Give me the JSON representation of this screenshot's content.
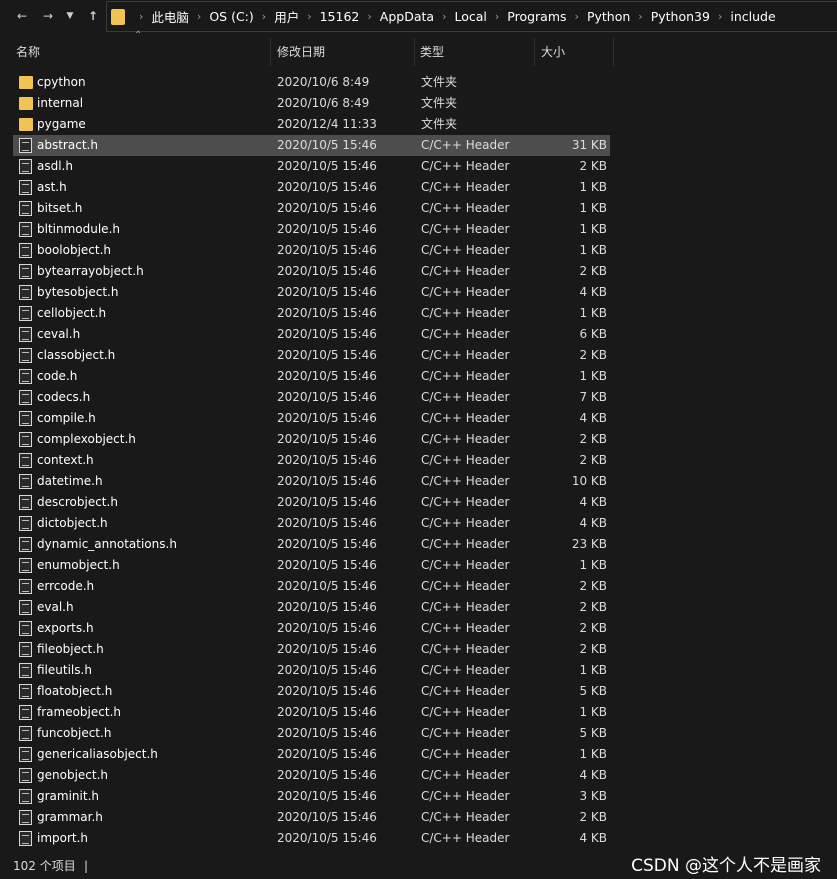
{
  "nav": {
    "back_icon": "arrow-left-icon",
    "forward_icon": "arrow-right-icon",
    "recent_icon": "chevron-down-icon",
    "up_icon": "arrow-up-icon"
  },
  "breadcrumb": [
    "此电脑",
    "OS (C:)",
    "用户",
    "15162",
    "AppData",
    "Local",
    "Programs",
    "Python",
    "Python39",
    "include"
  ],
  "columns": {
    "name": "名称",
    "date": "修改日期",
    "type": "类型",
    "size": "大小"
  },
  "files": [
    {
      "name": "cpython",
      "date": "2020/10/6 8:49",
      "type": "文件夹",
      "size": "",
      "kind": "folder"
    },
    {
      "name": "internal",
      "date": "2020/10/6 8:49",
      "type": "文件夹",
      "size": "",
      "kind": "folder"
    },
    {
      "name": "pygame",
      "date": "2020/12/4 11:33",
      "type": "文件夹",
      "size": "",
      "kind": "folder"
    },
    {
      "name": "abstract.h",
      "date": "2020/10/5 15:46",
      "type": "C/C++ Header",
      "size": "31 KB",
      "kind": "file",
      "selected": true
    },
    {
      "name": "asdl.h",
      "date": "2020/10/5 15:46",
      "type": "C/C++ Header",
      "size": "2 KB",
      "kind": "file"
    },
    {
      "name": "ast.h",
      "date": "2020/10/5 15:46",
      "type": "C/C++ Header",
      "size": "1 KB",
      "kind": "file"
    },
    {
      "name": "bitset.h",
      "date": "2020/10/5 15:46",
      "type": "C/C++ Header",
      "size": "1 KB",
      "kind": "file"
    },
    {
      "name": "bltinmodule.h",
      "date": "2020/10/5 15:46",
      "type": "C/C++ Header",
      "size": "1 KB",
      "kind": "file"
    },
    {
      "name": "boolobject.h",
      "date": "2020/10/5 15:46",
      "type": "C/C++ Header",
      "size": "1 KB",
      "kind": "file"
    },
    {
      "name": "bytearrayobject.h",
      "date": "2020/10/5 15:46",
      "type": "C/C++ Header",
      "size": "2 KB",
      "kind": "file"
    },
    {
      "name": "bytesobject.h",
      "date": "2020/10/5 15:46",
      "type": "C/C++ Header",
      "size": "4 KB",
      "kind": "file"
    },
    {
      "name": "cellobject.h",
      "date": "2020/10/5 15:46",
      "type": "C/C++ Header",
      "size": "1 KB",
      "kind": "file"
    },
    {
      "name": "ceval.h",
      "date": "2020/10/5 15:46",
      "type": "C/C++ Header",
      "size": "6 KB",
      "kind": "file"
    },
    {
      "name": "classobject.h",
      "date": "2020/10/5 15:46",
      "type": "C/C++ Header",
      "size": "2 KB",
      "kind": "file"
    },
    {
      "name": "code.h",
      "date": "2020/10/5 15:46",
      "type": "C/C++ Header",
      "size": "1 KB",
      "kind": "file"
    },
    {
      "name": "codecs.h",
      "date": "2020/10/5 15:46",
      "type": "C/C++ Header",
      "size": "7 KB",
      "kind": "file"
    },
    {
      "name": "compile.h",
      "date": "2020/10/5 15:46",
      "type": "C/C++ Header",
      "size": "4 KB",
      "kind": "file"
    },
    {
      "name": "complexobject.h",
      "date": "2020/10/5 15:46",
      "type": "C/C++ Header",
      "size": "2 KB",
      "kind": "file"
    },
    {
      "name": "context.h",
      "date": "2020/10/5 15:46",
      "type": "C/C++ Header",
      "size": "2 KB",
      "kind": "file"
    },
    {
      "name": "datetime.h",
      "date": "2020/10/5 15:46",
      "type": "C/C++ Header",
      "size": "10 KB",
      "kind": "file"
    },
    {
      "name": "descrobject.h",
      "date": "2020/10/5 15:46",
      "type": "C/C++ Header",
      "size": "4 KB",
      "kind": "file"
    },
    {
      "name": "dictobject.h",
      "date": "2020/10/5 15:46",
      "type": "C/C++ Header",
      "size": "4 KB",
      "kind": "file"
    },
    {
      "name": "dynamic_annotations.h",
      "date": "2020/10/5 15:46",
      "type": "C/C++ Header",
      "size": "23 KB",
      "kind": "file"
    },
    {
      "name": "enumobject.h",
      "date": "2020/10/5 15:46",
      "type": "C/C++ Header",
      "size": "1 KB",
      "kind": "file"
    },
    {
      "name": "errcode.h",
      "date": "2020/10/5 15:46",
      "type": "C/C++ Header",
      "size": "2 KB",
      "kind": "file"
    },
    {
      "name": "eval.h",
      "date": "2020/10/5 15:46",
      "type": "C/C++ Header",
      "size": "2 KB",
      "kind": "file"
    },
    {
      "name": "exports.h",
      "date": "2020/10/5 15:46",
      "type": "C/C++ Header",
      "size": "2 KB",
      "kind": "file"
    },
    {
      "name": "fileobject.h",
      "date": "2020/10/5 15:46",
      "type": "C/C++ Header",
      "size": "2 KB",
      "kind": "file"
    },
    {
      "name": "fileutils.h",
      "date": "2020/10/5 15:46",
      "type": "C/C++ Header",
      "size": "1 KB",
      "kind": "file"
    },
    {
      "name": "floatobject.h",
      "date": "2020/10/5 15:46",
      "type": "C/C++ Header",
      "size": "5 KB",
      "kind": "file"
    },
    {
      "name": "frameobject.h",
      "date": "2020/10/5 15:46",
      "type": "C/C++ Header",
      "size": "1 KB",
      "kind": "file"
    },
    {
      "name": "funcobject.h",
      "date": "2020/10/5 15:46",
      "type": "C/C++ Header",
      "size": "5 KB",
      "kind": "file"
    },
    {
      "name": "genericaliasobject.h",
      "date": "2020/10/5 15:46",
      "type": "C/C++ Header",
      "size": "1 KB",
      "kind": "file"
    },
    {
      "name": "genobject.h",
      "date": "2020/10/5 15:46",
      "type": "C/C++ Header",
      "size": "4 KB",
      "kind": "file"
    },
    {
      "name": "graminit.h",
      "date": "2020/10/5 15:46",
      "type": "C/C++ Header",
      "size": "3 KB",
      "kind": "file"
    },
    {
      "name": "grammar.h",
      "date": "2020/10/5 15:46",
      "type": "C/C++ Header",
      "size": "2 KB",
      "kind": "file"
    },
    {
      "name": "import.h",
      "date": "2020/10/5 15:46",
      "type": "C/C++ Header",
      "size": "4 KB",
      "kind": "file"
    }
  ],
  "status": {
    "item_count": "102 个项目",
    "caret": "|"
  },
  "watermark": "CSDN @这个人不是画家",
  "colors": {
    "background": "#191919",
    "selected_row": "#4d4d4d",
    "folder": "#f0c454"
  }
}
